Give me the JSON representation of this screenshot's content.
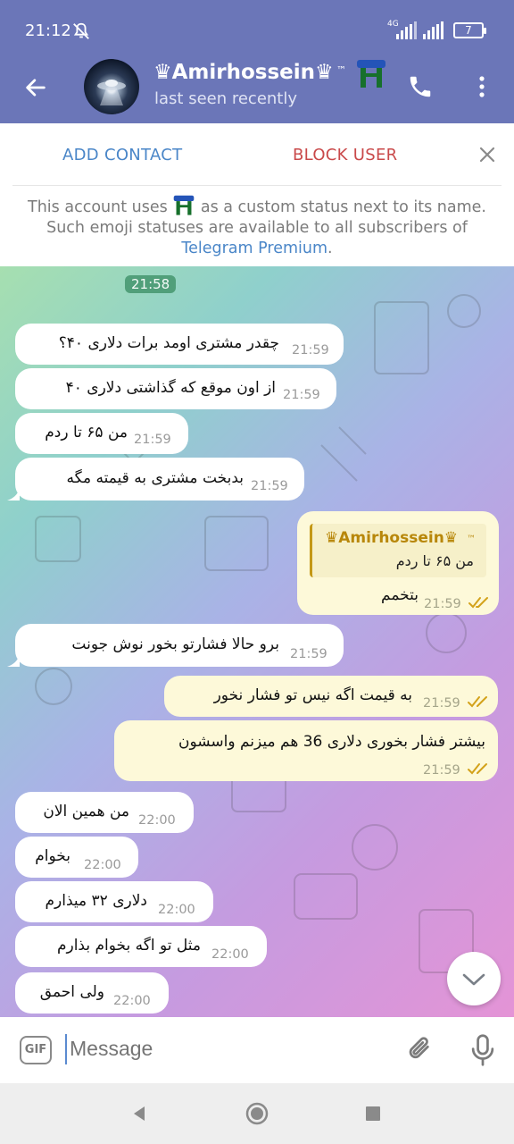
{
  "status_bar": {
    "time": "21:12",
    "network": "4G",
    "battery": "7"
  },
  "header": {
    "name": "♛Amirhossein♛",
    "trademark": "™",
    "status": "last seen recently",
    "icons": {
      "back": "back-arrow-icon",
      "call": "phone-icon",
      "more": "more-vertical-icon",
      "emoji_status": "stool-emoji-icon"
    }
  },
  "contact_panel": {
    "add_contact": "ADD CONTACT",
    "block_user": "BLOCK USER",
    "info_before": "This account uses ",
    "info_after": " as a custom status next to its name. Such emoji statuses are available to all subscribers of ",
    "info_link": "Telegram Premium",
    "info_end": "."
  },
  "chat": {
    "date_pill": "21:58",
    "messages": [
      {
        "dir": "in",
        "text": "چقدر مشتری اومد برات دلاری ۴۰؟",
        "time": "21:59"
      },
      {
        "dir": "in",
        "text": "از اون موقع که گذاشتی دلاری ۴۰",
        "time": "21:59"
      },
      {
        "dir": "in",
        "text": "من ۶۵ تا ردم",
        "time": "21:59"
      },
      {
        "dir": "in",
        "text": "بدبخت مشتری به قیمته مگه",
        "time": "21:59"
      },
      {
        "dir": "out",
        "reply_name": "♛Amirhossein♛",
        "reply_tm": "™",
        "reply_text": "من ۶۵ تا ردم",
        "text": "بتخمم",
        "time": "21:59",
        "read": true
      },
      {
        "dir": "in",
        "text": "برو حالا فشارتو بخور نوش جونت",
        "time": "21:59"
      },
      {
        "dir": "out",
        "text": "به قیمت اگه نیس تو فشار نخور",
        "time": "21:59",
        "read": true
      },
      {
        "dir": "out",
        "text": "بیشتر فشار بخوری دلاری 36 هم میزنم واسشون",
        "time": "21:59",
        "read": true
      },
      {
        "dir": "in",
        "text": "من همین الان",
        "time": "22:00"
      },
      {
        "dir": "in",
        "text": "بخوام",
        "time": "22:00"
      },
      {
        "dir": "in",
        "text": "دلاری ۳۲ میذارم",
        "time": "22:00"
      },
      {
        "dir": "in",
        "text": "مثل تو اگه بخوام بذارم",
        "time": "22:00"
      },
      {
        "dir": "in",
        "text": "ولی احمق",
        "time": "22:00"
      }
    ]
  },
  "input": {
    "placeholder": "Message",
    "gif_label": "GIF"
  },
  "colors": {
    "header": "#6b76b8",
    "link": "#4a86c8",
    "danger": "#c9494a",
    "out_bubble": "#fdf9d9",
    "in_bubble": "#ffffff"
  }
}
